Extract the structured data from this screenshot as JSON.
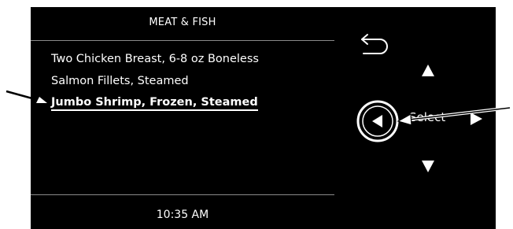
{
  "screen": {
    "title": "MEAT & FISH",
    "items": [
      {
        "label": "Two Chicken Breast, 6-8 oz Boneless"
      },
      {
        "label": "Salmon Fillets, Steamed"
      },
      {
        "label": "Jumbo Shrimp, Frozen, Steamed",
        "selected": true
      }
    ],
    "time": "10:35 AM"
  },
  "controls": {
    "back_icon": "back-arrow-icon",
    "up_icon": "triangle-up-icon",
    "down_icon": "triangle-down-icon",
    "left_icon": "triangle-left-icon",
    "right_icon": "triangle-right-icon",
    "select_label": "Select"
  },
  "colors": {
    "background": "#000000",
    "text": "#ffffff",
    "divider": "#8a8a8a",
    "page": "#ffffff"
  }
}
